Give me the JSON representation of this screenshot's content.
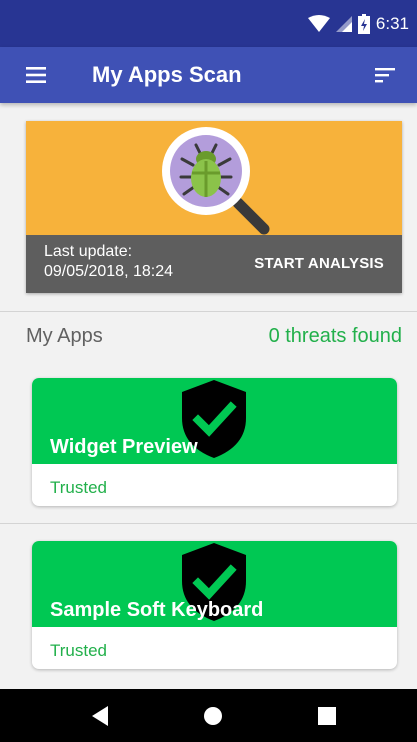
{
  "status_bar": {
    "time": "6:31"
  },
  "app_bar": {
    "title": "My Apps Scan"
  },
  "scan_card": {
    "last_update_label": "Last update:",
    "last_update_value": "09/05/2018, 18:24",
    "start_button_label": "START ANALYSIS"
  },
  "apps_section": {
    "header_label": "My Apps",
    "threats_text": "0 threats found",
    "apps": [
      {
        "name": "Widget Preview",
        "status": "Trusted"
      },
      {
        "name": "Sample Soft Keyboard",
        "status": "Trusted"
      }
    ]
  },
  "colors": {
    "status_bar": "#283593",
    "app_bar": "#3f51b5",
    "scan_card": "#f7b23b",
    "scan_footer": "#5e5e5e",
    "trusted_green": "#00c853"
  },
  "icons": [
    "wifi-icon",
    "signal-icon",
    "battery-icon",
    "menu-icon",
    "sort-icon",
    "bug-magnifier-illustration",
    "shield-check-icon",
    "back-icon",
    "home-icon",
    "recents-icon"
  ]
}
